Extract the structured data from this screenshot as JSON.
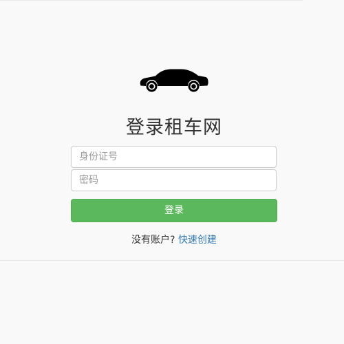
{
  "header": {
    "logo_icon": "car-icon",
    "title": "登录租车网"
  },
  "form": {
    "id_card": {
      "placeholder": "身份证号",
      "value": ""
    },
    "password": {
      "placeholder": "密码",
      "value": ""
    },
    "login_label": "登录"
  },
  "signup": {
    "prompt": "没有账户?",
    "link_label": "快速创建"
  },
  "colors": {
    "primary_button": "#5cb85c",
    "link": "#337ab7",
    "background": "#f9f9f9"
  }
}
